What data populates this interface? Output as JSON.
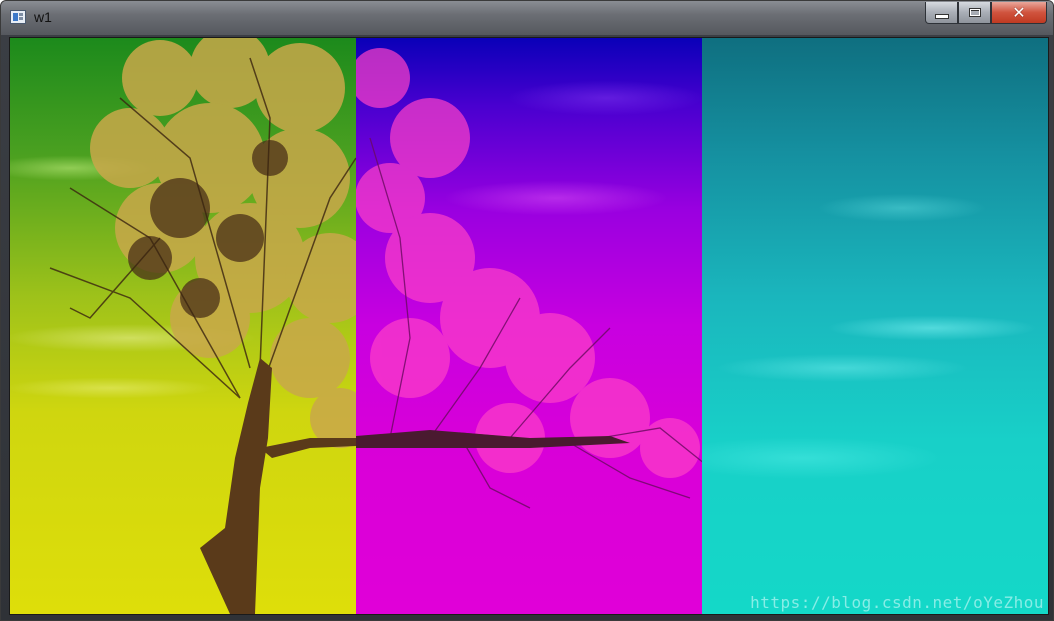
{
  "window": {
    "title": "w1",
    "icon": "opencv-window-icon",
    "buttons": {
      "minimize": "minimize-icon",
      "maximize": "maximize-icon",
      "close": "close-icon"
    }
  },
  "image": {
    "panels": [
      {
        "name": "green-yellow-channel",
        "color_top": "#1c8a1c",
        "color_bottom": "#dede0a"
      },
      {
        "name": "blue-magenta-channel",
        "color_top": "#0a00b8",
        "color_bottom": "#e000d8"
      },
      {
        "name": "cyan-channel",
        "color_top": "#0f6f80",
        "color_bottom": "#14d8c8"
      }
    ],
    "watermark": "https://blog.csdn.net/oYeZhou"
  }
}
